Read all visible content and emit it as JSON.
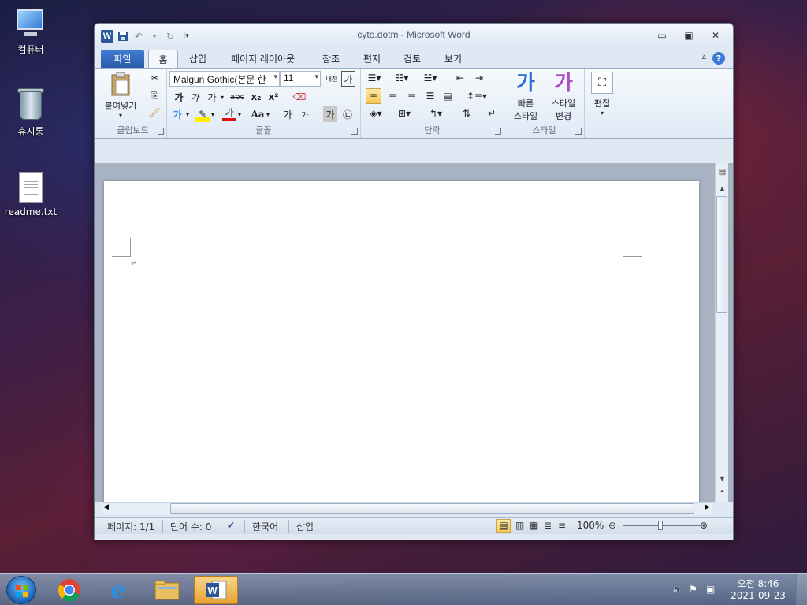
{
  "desktop": {
    "icons": [
      {
        "label": "컴퓨터"
      },
      {
        "label": "휴지통"
      },
      {
        "label": "readme.txt"
      }
    ]
  },
  "window": {
    "title": "cyto.dotm  -  Microsoft Word",
    "app_icon_letter": "W"
  },
  "tabs": {
    "file": "파일",
    "home": "홈",
    "insert": "삽입",
    "layout": "페이지 레이아웃",
    "references": "참조",
    "mailings": "편지",
    "review": "검토",
    "view": "보기"
  },
  "ribbon": {
    "clipboard": {
      "paste_label": "붙여넣기",
      "group_label": "클립보드"
    },
    "font": {
      "font_name": "Malgun Gothic(본문 한",
      "font_size": "11",
      "group_label": "글꼴",
      "bold": "가",
      "italic": "가",
      "underline": "가",
      "strike": "abc",
      "subscript": "x₂",
      "superscript": "x²",
      "font_color": "가",
      "change_case": "Aa",
      "grow": "가",
      "shrink": "가",
      "char_shading": "가",
      "enclose": "㉡",
      "phonetic": "내천",
      "char_border": "가"
    },
    "paragraph": {
      "group_label": "단락"
    },
    "styles": {
      "quick_label_1": "빠른",
      "quick_label_2": "스타일",
      "change_label_1": "스타일",
      "change_label_2": "변경",
      "sample_1": "가",
      "sample_2": "가",
      "group_label": "스타일"
    },
    "editing": {
      "label": "편집"
    }
  },
  "document": {
    "paragraph_mark": "↵"
  },
  "status": {
    "page": "페이지: 1/1",
    "words": "단어 수: 0",
    "language": "한국어",
    "mode": "삽입",
    "zoom": "100%"
  },
  "taskbar": {
    "clock_time": "오전 8:46",
    "clock_date": "2021-09-23"
  },
  "colors": {
    "accent": "#2b5797",
    "file_tab": "#2a5aa8"
  }
}
